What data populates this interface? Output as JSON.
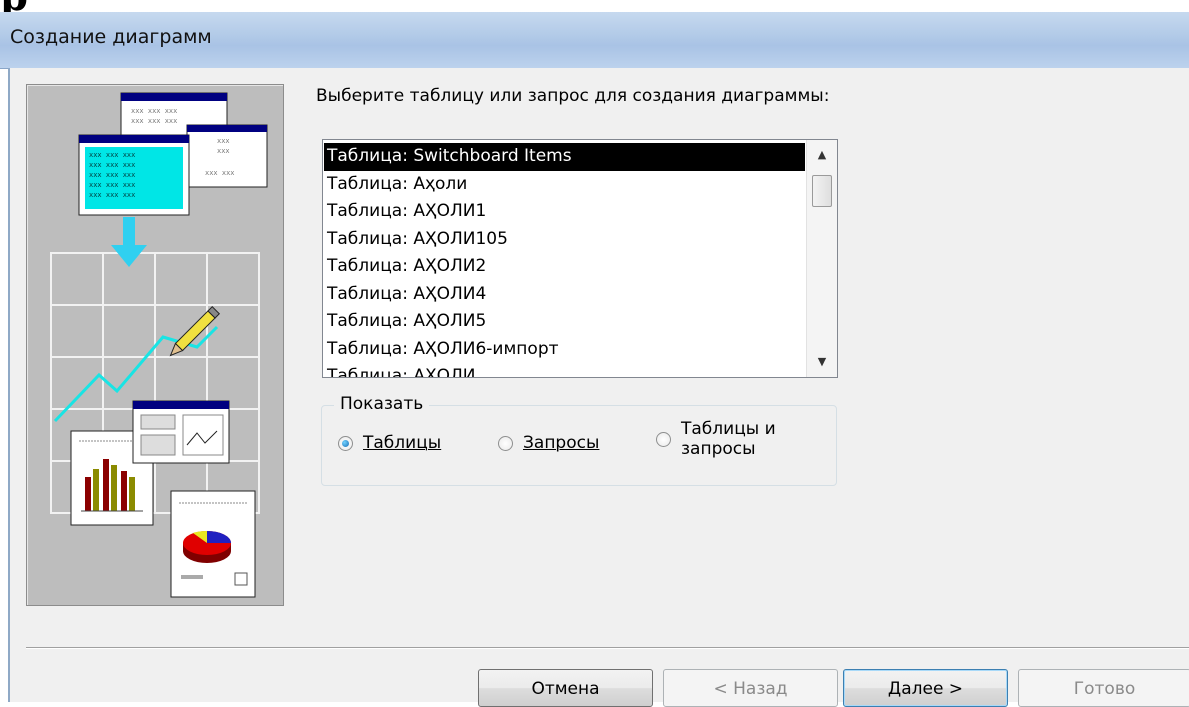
{
  "window": {
    "title": "Создание диаграмм",
    "background_fragment": "р"
  },
  "prompt": "Выберите таблицу или запрос для создания диаграммы:",
  "list": {
    "items": [
      "Таблица: Switchboard Items",
      "Таблица: Аҳоли",
      "Таблица: АҲОЛИ1",
      "Таблица: АҲОЛИ105",
      "Таблица: АҲОЛИ2",
      "Таблица: АҲОЛИ4",
      "Таблица: АҲОЛИ5",
      "Таблица: АҲОЛИ6-импорт",
      "Таблица: АҲОЛИ..."
    ],
    "selected_index": 0
  },
  "show_group": {
    "label": "Показать",
    "options": [
      {
        "label": "Таблицы",
        "checked": true
      },
      {
        "label": "Запросы",
        "checked": false
      },
      {
        "label_line1": "Таблицы и",
        "label_line2": "запросы",
        "checked": false
      }
    ]
  },
  "buttons": {
    "cancel": "Отмена",
    "back": "< Назад",
    "next": "Далее >",
    "finish": "Готово"
  },
  "colors": {
    "titlebar": "#b3cbe8",
    "selection": "#000000",
    "illustration_bg": "#bdbdbd"
  }
}
